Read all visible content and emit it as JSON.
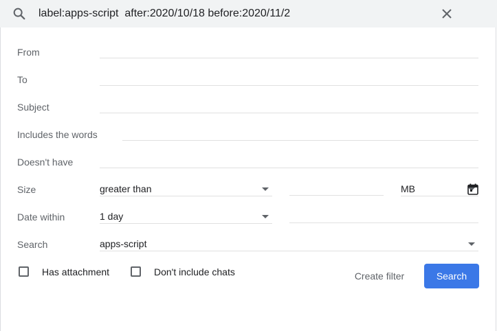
{
  "search_bar": {
    "query": "label:apps-script  after:2020/10/18 before:2020/11/2"
  },
  "form": {
    "from_label": "From",
    "from_value": "",
    "to_label": "To",
    "to_value": "",
    "subject_label": "Subject",
    "subject_value": "",
    "includes_label": "Includes the words",
    "includes_value": "",
    "doesnt_have_label": "Doesn't have",
    "doesnt_have_value": "",
    "size_label": "Size",
    "size_operator": "greater than",
    "size_value": "",
    "size_unit": "MB",
    "date_within_label": "Date within",
    "date_within_value": "1 day",
    "date_value": "",
    "search_label": "Search",
    "search_scope": "apps-script",
    "has_attachment_label": "Has attachment",
    "has_attachment_checked": false,
    "dont_include_chats_label": "Don't include chats",
    "dont_include_chats_checked": false
  },
  "actions": {
    "create_filter_label": "Create filter",
    "search_label": "Search"
  },
  "colors": {
    "accent": "#3b78e7",
    "searchbar_bg": "#f1f3f4",
    "label_text": "#5f6368"
  }
}
